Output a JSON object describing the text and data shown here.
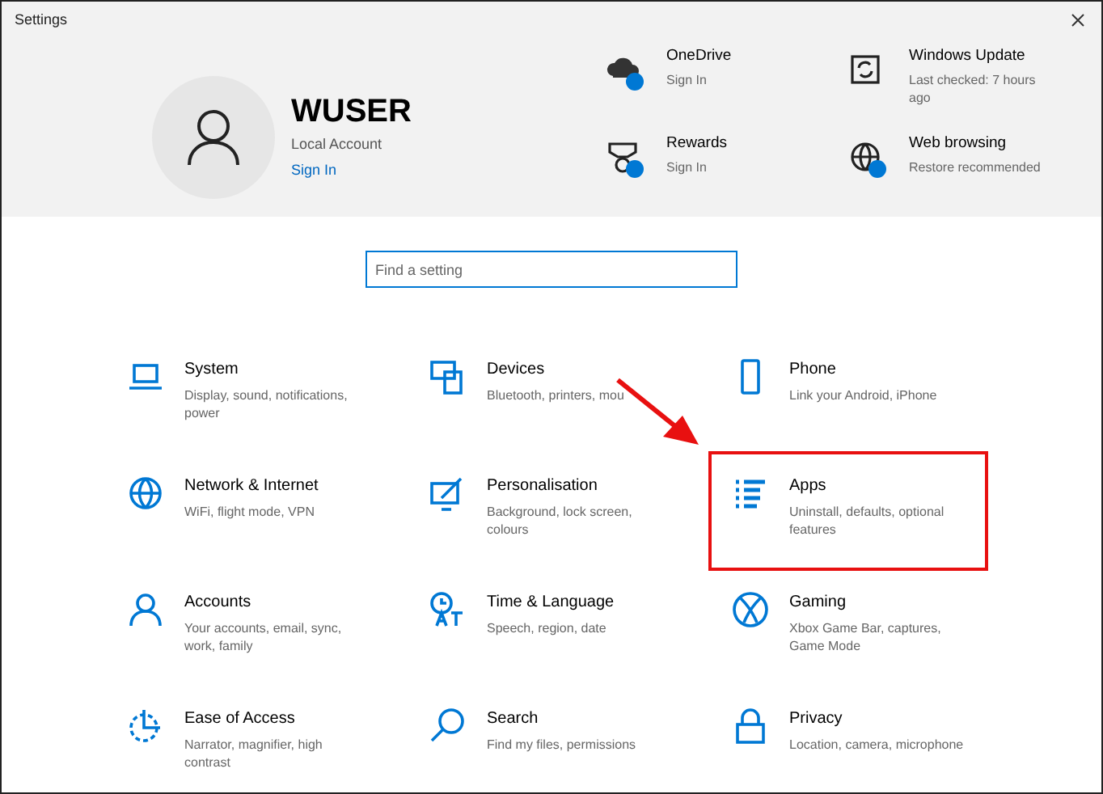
{
  "window": {
    "title": "Settings"
  },
  "account": {
    "name": "WUSER",
    "type": "Local Account",
    "link": "Sign In"
  },
  "quick_links": [
    {
      "title": "OneDrive",
      "subtitle": "Sign In",
      "badge": true
    },
    {
      "title": "Windows Update",
      "subtitle": "Last checked: 7 hours ago",
      "badge": false
    },
    {
      "title": "Rewards",
      "subtitle": "Sign In",
      "badge": true
    },
    {
      "title": "Web browsing",
      "subtitle": "Restore recommended",
      "badge": true
    }
  ],
  "search": {
    "placeholder": "Find a setting"
  },
  "categories": [
    {
      "title": "System",
      "subtitle": "Display, sound, notifications, power",
      "highlighted": false
    },
    {
      "title": "Devices",
      "subtitle": "Bluetooth, printers, mou",
      "highlighted": false
    },
    {
      "title": "Phone",
      "subtitle": "Link your Android, iPhone",
      "highlighted": false
    },
    {
      "title": "Network & Internet",
      "subtitle": "WiFi, flight mode, VPN",
      "highlighted": false
    },
    {
      "title": "Personalisation",
      "subtitle": "Background, lock screen, colours",
      "highlighted": false
    },
    {
      "title": "Apps",
      "subtitle": "Uninstall, defaults, optional features",
      "highlighted": true
    },
    {
      "title": "Accounts",
      "subtitle": "Your accounts, email, sync, work, family",
      "highlighted": false
    },
    {
      "title": "Time & Language",
      "subtitle": "Speech, region, date",
      "highlighted": false
    },
    {
      "title": "Gaming",
      "subtitle": "Xbox Game Bar, captures, Game Mode",
      "highlighted": false
    },
    {
      "title": "Ease of Access",
      "subtitle": "Narrator, magnifier, high contrast",
      "highlighted": false
    },
    {
      "title": "Search",
      "subtitle": "Find my files, permissions",
      "highlighted": false
    },
    {
      "title": "Privacy",
      "subtitle": "Location, camera, microphone",
      "highlighted": false
    }
  ],
  "annotation": {
    "arrow": true
  }
}
